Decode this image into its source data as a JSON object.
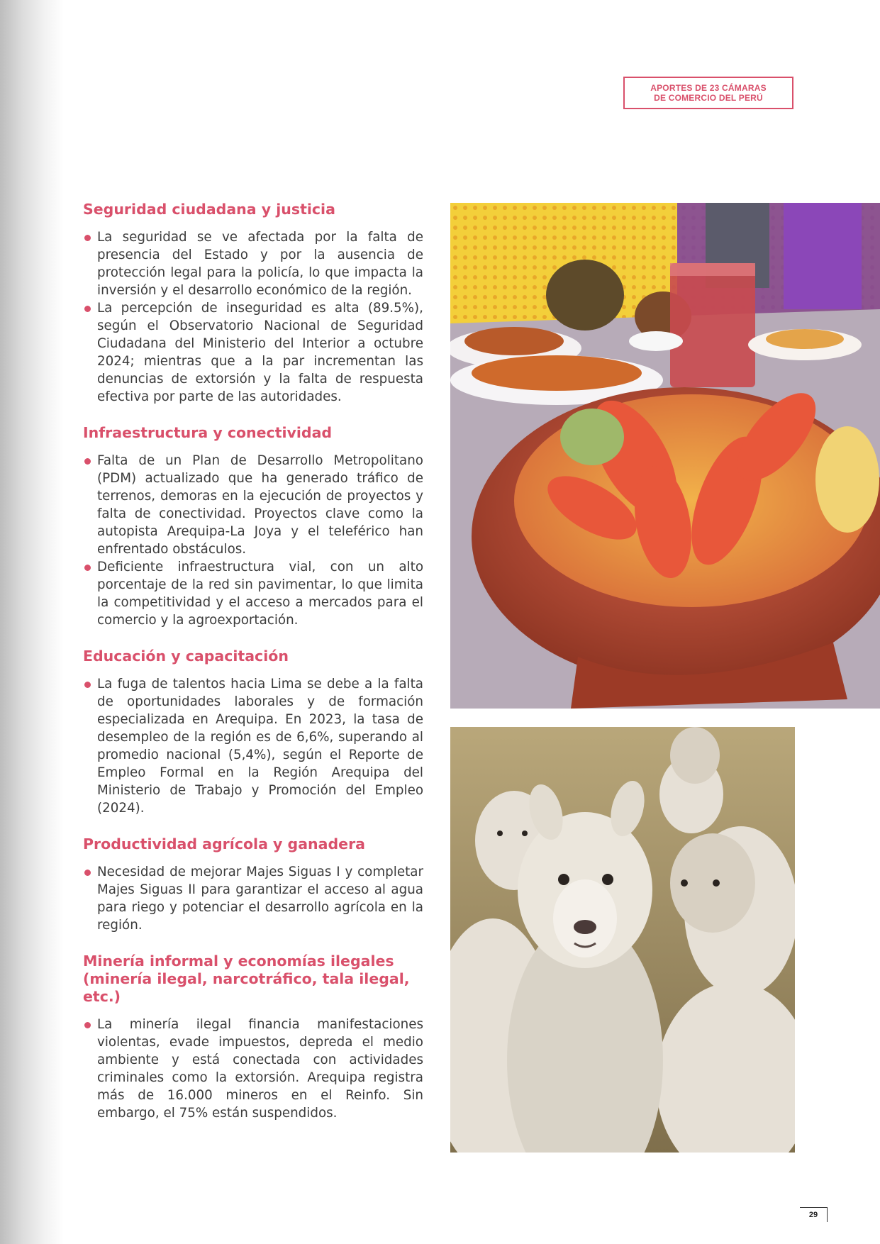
{
  "header": {
    "line1": "APORTES DE 23 CÁMARAS",
    "line2": "DE COMERCIO DEL PERÚ"
  },
  "sections": [
    {
      "title": "Seguridad ciudadana y justicia",
      "bullets": [
        "La seguridad se ve afectada por la falta de presencia del Estado y por la ausencia de protección legal para la policía, lo que impacta la inversión y el desarrollo económico de la región.",
        "La percepción de inseguridad es alta (89.5%), según el Observatorio Nacional de Seguridad Ciudadana del Ministerio del Interior a octubre 2024; mientras que a la par incrementan las denuncias de extorsión y la falta de respuesta efectiva por parte de las autoridades."
      ]
    },
    {
      "title": "Infraestructura y conectividad",
      "bullets": [
        "Falta de un Plan de Desarrollo Metropolitano (PDM) actualizado que ha generado tráfico de terrenos, demoras en la ejecución de proyectos y falta de conectividad. Proyectos clave como la autopista Arequipa-La Joya y el teleférico han enfrentado obstáculos.",
        "Deficiente infraestructura vial, con un alto porcentaje de la red sin pavimentar, lo que limita la competitividad y el acceso a mercados para el comercio y la agroexportación."
      ]
    },
    {
      "title": "Educación y capacitación",
      "bullets": [
        "La fuga de talentos hacia Lima se debe a la falta de oportunidades laborales y de formación especializada en Arequipa. En 2023, la tasa de desempleo de la región es de 6,6%, superando al promedio nacional (5,4%), según el Reporte de Empleo Formal en la Región Arequipa del Ministerio de Trabajo y Promoción del Empleo (2024)."
      ]
    },
    {
      "title": "Productividad agrícola y ganadera",
      "bullets": [
        "Necesidad de mejorar Majes Siguas I y completar Majes Siguas II para garantizar el acceso al agua para riego y potenciar el desarrollo agrícola en la región."
      ]
    },
    {
      "title": "Minería informal y economías ilegales (minería ilegal, narcotráfico, tala ilegal, etc.)",
      "bullets": [
        "La minería ilegal financia manifestaciones violentas, evade impuestos, depreda el medio ambiente y está conectada con actividades criminales como la extorsión. Arequipa registra más de 16.000 mineros en el Reinfo. Sin embargo, el 75% están suspendidos."
      ]
    }
  ],
  "page_number": "29",
  "colors": {
    "accent": "#d9506b",
    "text": "#3c3c3c"
  }
}
